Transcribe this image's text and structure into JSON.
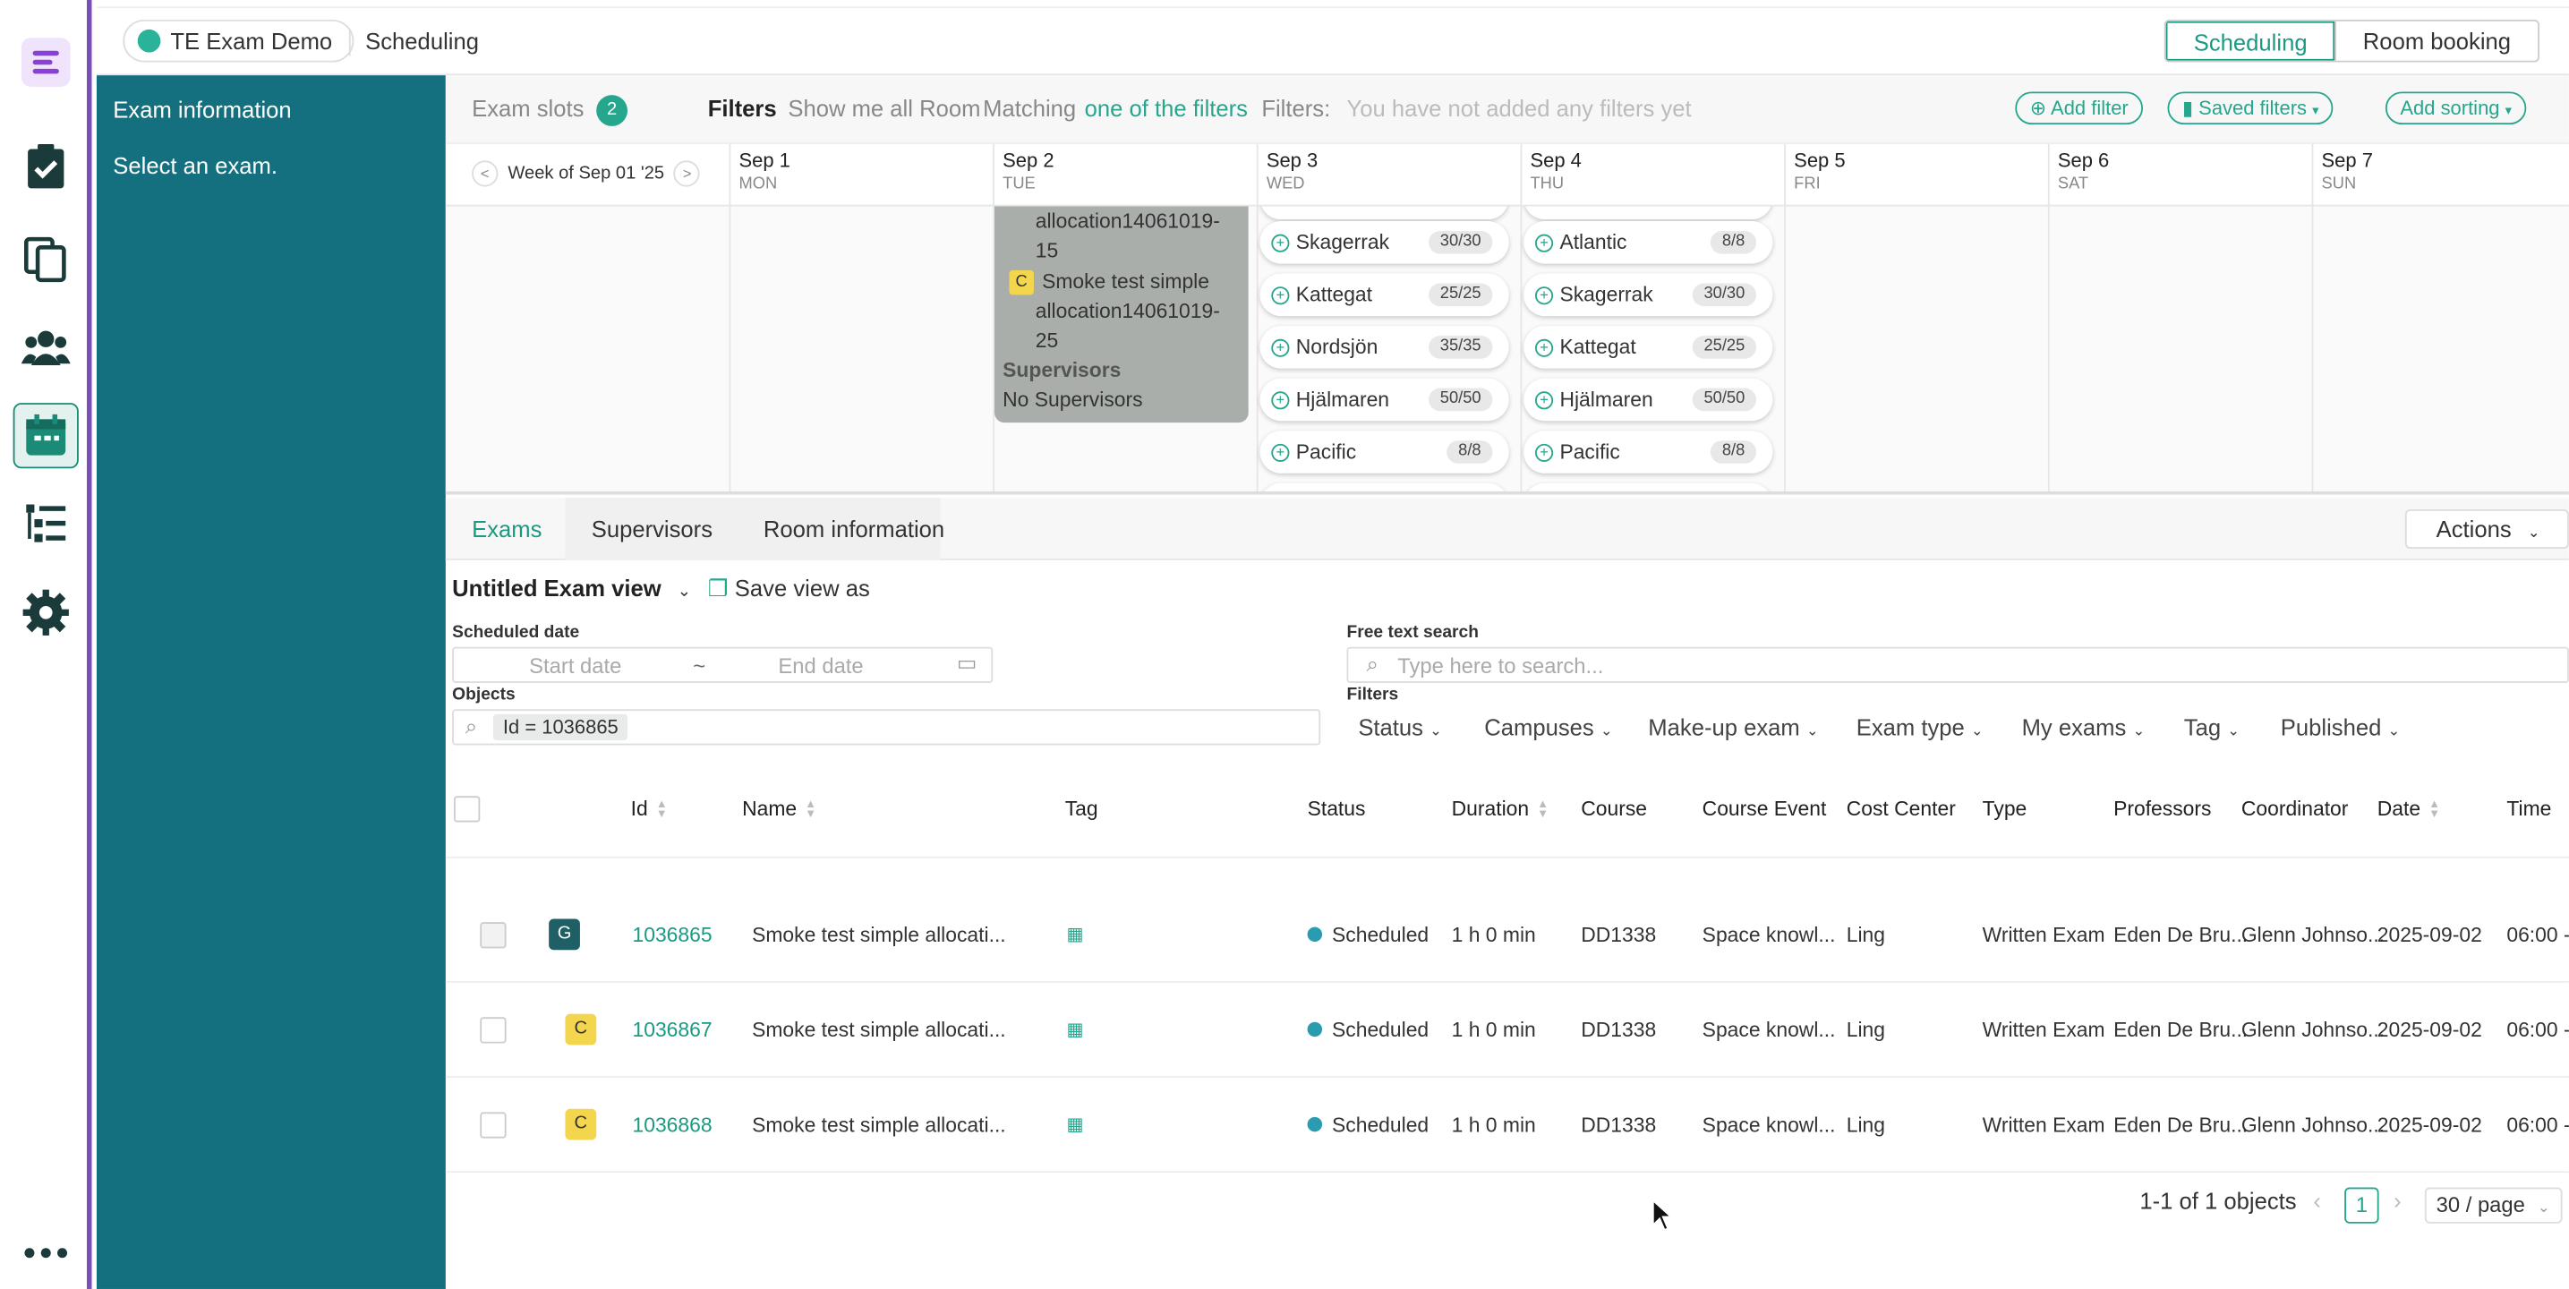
{
  "topbar": {
    "org": "TE Exam Demo",
    "crumb": "Scheduling",
    "modes": [
      "Scheduling",
      "Room booking"
    ]
  },
  "sidepanel": {
    "title": "Exam information",
    "hint": "Select an exam."
  },
  "filterbar": {
    "exam_slots": "Exam slots",
    "slot_count": "2",
    "filters": "Filters",
    "show_all": "Show me all Room",
    "matching": "Matching",
    "matching_mode": "one of the filters",
    "filters_label": "Filters:",
    "no_filters": "You have not added any filters yet",
    "add_filter": "Add filter",
    "saved_filters": "Saved filters",
    "add_sorting": "Add sorting"
  },
  "calendar": {
    "week_label": "Week of Sep 01 '25",
    "days": [
      {
        "date": "Sep 1",
        "weekday": "MON"
      },
      {
        "date": "Sep 2",
        "weekday": "TUE"
      },
      {
        "date": "Sep 3",
        "weekday": "WED"
      },
      {
        "date": "Sep 4",
        "weekday": "THU"
      },
      {
        "date": "Sep 5",
        "weekday": "FRI"
      },
      {
        "date": "Sep 6",
        "weekday": "SAT"
      },
      {
        "date": "Sep 7",
        "weekday": "SUN"
      }
    ],
    "slot_card": {
      "line1": "allocation14061019-",
      "line2": "15",
      "exam_badge": "C",
      "exam_line1": "Smoke test simple",
      "exam_line2": "allocation14061019-",
      "exam_line3": "25",
      "supervisors_label": "Supervisors",
      "supervisors_value": "No Supervisors"
    },
    "wed_rooms": [
      {
        "name": "Skagerrak",
        "cap": "30/30"
      },
      {
        "name": "Kattegat",
        "cap": "25/25"
      },
      {
        "name": "Nordsjön",
        "cap": "35/35"
      },
      {
        "name": "Hjälmaren",
        "cap": "50/50"
      },
      {
        "name": "Pacific",
        "cap": "8/8"
      }
    ],
    "thu_rooms": [
      {
        "name": "Atlantic",
        "cap": "8/8"
      },
      {
        "name": "Skagerrak",
        "cap": "30/30"
      },
      {
        "name": "Kattegat",
        "cap": "25/25"
      },
      {
        "name": "Hjälmaren",
        "cap": "50/50"
      },
      {
        "name": "Pacific",
        "cap": "8/8"
      }
    ]
  },
  "tabs": {
    "items": [
      "Exams",
      "Supervisors",
      "Room information"
    ],
    "actions": "Actions"
  },
  "view": {
    "name": "Untitled Exam view",
    "save_as": "Save view as",
    "scheduled_date": "Scheduled date",
    "start_placeholder": "Start date",
    "tilde": "~",
    "end_placeholder": "End date",
    "free_text": "Free text search",
    "search_placeholder": "Type here to search...",
    "objects": "Objects",
    "object_chip": "Id = 1036865",
    "filters": "Filters",
    "filter_dropdowns": [
      "Status",
      "Campuses",
      "Make-up exam",
      "Exam type",
      "My exams",
      "Tag",
      "Published"
    ]
  },
  "table": {
    "headers": {
      "id": "Id",
      "name": "Name",
      "tag": "Tag",
      "status": "Status",
      "duration": "Duration",
      "course": "Course",
      "course_event": "Course Event",
      "cost_center": "Cost Center",
      "type": "Type",
      "professors": "Professors",
      "coordinator": "Coordinator",
      "date": "Date",
      "time": "Time"
    },
    "rows": [
      {
        "badge": "G",
        "id": "1036865",
        "name": "Smoke test simple allocati...",
        "status": "Scheduled",
        "duration": "1 h 0 min",
        "course": "DD1338",
        "course_event": "Space knowl...",
        "cost_center": "Ling",
        "type": "Written Exam",
        "professors": "Eden De Bru...",
        "coordinator": "Glenn Johnso...",
        "date": "2025-09-02",
        "time": "06:00 -"
      },
      {
        "badge": "C",
        "id": "1036867",
        "name": "Smoke test simple allocati...",
        "status": "Scheduled",
        "duration": "1 h 0 min",
        "course": "DD1338",
        "course_event": "Space knowl...",
        "cost_center": "Ling",
        "type": "Written Exam",
        "professors": "Eden De Bru...",
        "coordinator": "Glenn Johnso...",
        "date": "2025-09-02",
        "time": "06:00 -"
      },
      {
        "badge": "C",
        "id": "1036868",
        "name": "Smoke test simple allocati...",
        "status": "Scheduled",
        "duration": "1 h 0 min",
        "course": "DD1338",
        "course_event": "Space knowl...",
        "cost_center": "Ling",
        "type": "Written Exam",
        "professors": "Eden De Bru...",
        "coordinator": "Glenn Johnso...",
        "date": "2025-09-02",
        "time": "06:00 -"
      }
    ]
  },
  "pagination": {
    "summary": "1-1 of 1 objects",
    "page": "1",
    "per_page": "30 / page"
  },
  "colors": {
    "accent": "#26a68d",
    "sidepanel": "#14707e",
    "rail_border": "#7c4dbd",
    "badge_g": "#1f5f66",
    "badge_c": "#f3d64e"
  }
}
